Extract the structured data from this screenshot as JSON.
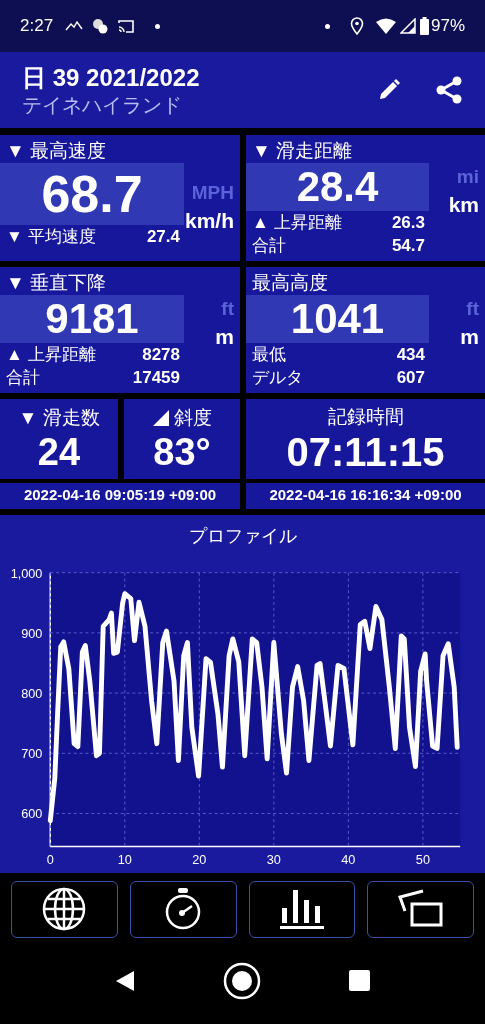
{
  "status_bar": {
    "time": "2:27",
    "battery": "97%"
  },
  "header": {
    "title": "日 39 2021/2022",
    "subtitle": "テイネハイランド"
  },
  "stats": [
    {
      "label": "▼ 最高速度",
      "value": "68.7",
      "units": [
        {
          "label": "MPH",
          "selected": false
        },
        {
          "label": "km/h",
          "selected": true
        }
      ],
      "rows": [
        {
          "label": "▼ 平均速度",
          "value": "27.4"
        }
      ]
    },
    {
      "label": "▼ 滑走距離",
      "value": "28.4",
      "units": [
        {
          "label": "mi",
          "selected": false
        },
        {
          "label": "km",
          "selected": true
        }
      ],
      "rows": [
        {
          "label": "▲ 上昇距離",
          "value": "26.3"
        },
        {
          "label": "合計",
          "value": "54.7"
        }
      ]
    },
    {
      "label": "▼ 垂直下降",
      "value": "9181",
      "units": [
        {
          "label": "ft",
          "selected": false
        },
        {
          "label": "m",
          "selected": true
        }
      ],
      "rows": [
        {
          "label": "▲ 上昇距離",
          "value": "8278"
        },
        {
          "label": "合計",
          "value": "17459"
        }
      ]
    },
    {
      "label": "最高高度",
      "value": "1041",
      "units": [
        {
          "label": "ft",
          "selected": false
        },
        {
          "label": "m",
          "selected": true
        }
      ],
      "rows": [
        {
          "label": "最低",
          "value": "434"
        },
        {
          "label": "デルタ",
          "value": "607"
        }
      ]
    }
  ],
  "tiles": [
    {
      "kind": "count",
      "label": "▼ 滑走数",
      "value": "24"
    },
    {
      "kind": "slope",
      "label": "斜度",
      "value": "83°"
    },
    {
      "kind": "duration",
      "label": "記録時間",
      "value": "07:11:15"
    }
  ],
  "times": [
    "2022-04-16 09:05:19 +09:00",
    "2022-04-16 16:16:34 +09:00"
  ],
  "profile": {
    "chart_data": {
      "type": "line",
      "title": "プロファイル",
      "xlim": [
        0,
        55
      ],
      "ylim": [
        545,
        1000
      ],
      "xticks": [
        0,
        10,
        20,
        30,
        40,
        50
      ],
      "yticks": [
        600,
        700,
        800,
        900,
        {
          "value": 1000,
          "label": "1,000"
        }
      ],
      "x": [
        0,
        0.6,
        1,
        1.4,
        1.8,
        2.5,
        3.2,
        3.7,
        4.3,
        4.7,
        5.3,
        6.2,
        6.6,
        7.1,
        7.9,
        8.2,
        8.5,
        9,
        9.7,
        10,
        10.8,
        11.3,
        11.9,
        12.7,
        13.6,
        14.3,
        15.1,
        15.6,
        16.6,
        17.2,
        17.9,
        18.4,
        19,
        19.9,
        20.9,
        21.5,
        22.5,
        23.1,
        24,
        24.5,
        25.3,
        26.1,
        27.1,
        27.7,
        28.4,
        29.1,
        30,
        31,
        31.7,
        32.5,
        33.2,
        34,
        34.7,
        35.8,
        36.2,
        36.9,
        37.6,
        38.6,
        39.4,
        40.6,
        41.6,
        42.2,
        42.9,
        43.7,
        44.5,
        45.5,
        46.3,
        47.1,
        47.5,
        48.2,
        49,
        49.7,
        50.3,
        50.5,
        51.3,
        51.9,
        52.7,
        53.4,
        54.2,
        54.6
      ],
      "grid": true,
      "series": [
        {
          "color": "#ffffff",
          "values": [
            588,
            658,
            770,
            877,
            885,
            840,
            716,
            711,
            868,
            879,
            820,
            696,
            700,
            911,
            922,
            933,
            866,
            868,
            949,
            965,
            957,
            887,
            951,
            911,
            787,
            716,
            884,
            903,
            820,
            688,
            862,
            884,
            743,
            662,
            857,
            851,
            765,
            677,
            862,
            890,
            852,
            696,
            890,
            884,
            810,
            691,
            884,
            733,
            667,
            810,
            844,
            787,
            688,
            846,
            849,
            782,
            712,
            846,
            841,
            714,
            914,
            919,
            874,
            944,
            922,
            810,
            708,
            895,
            890,
            743,
            678,
            836,
            865,
            820,
            712,
            708,
            862,
            882,
            810,
            710
          ]
        }
      ]
    }
  }
}
